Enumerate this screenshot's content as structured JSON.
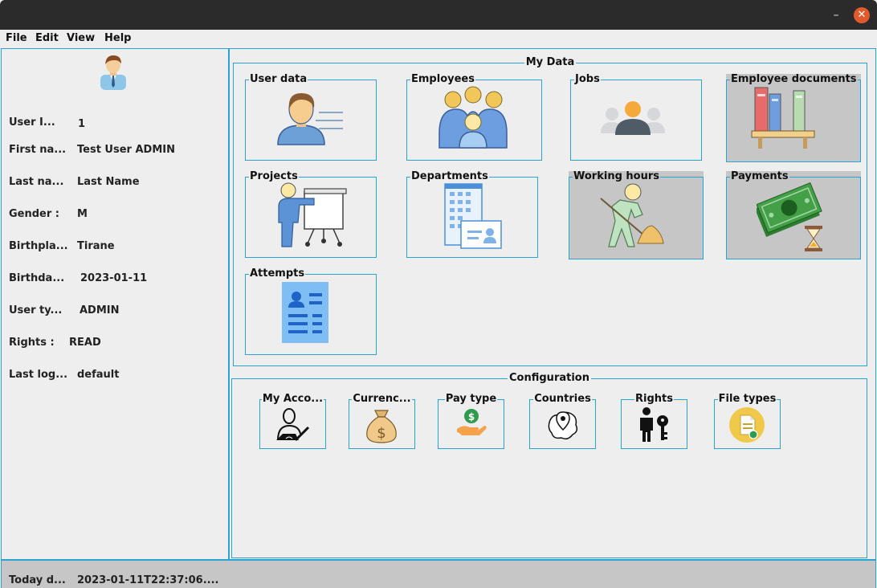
{
  "window": {
    "min_glyph": "–",
    "close_glyph": "✕"
  },
  "menu": {
    "file": "File",
    "edit": "Edit",
    "view": "View",
    "help": "Help"
  },
  "user": {
    "id_label": "User I...",
    "id_value": "1",
    "first_label": "First na...",
    "first_value": "Test User ADMIN",
    "last_label": "Last na...",
    "last_value": "Last Name",
    "gender_label": "Gender :",
    "gender_value": "M",
    "birthplace_label": "Birthpla...",
    "birthplace_value": "Tirane",
    "birthday_label": "Birthda...",
    "birthday_value": "2023-01-11",
    "type_label": "User ty...",
    "type_value": "ADMIN",
    "rights_label": "Rights  :",
    "rights_value": "READ",
    "lastlog_label": "Last log...",
    "lastlog_value": "default"
  },
  "mydata": {
    "title": "My Data",
    "user_data": "User data",
    "employees": "Employees",
    "jobs": "Jobs",
    "employee_documents": "Employee documents",
    "projects": "Projects",
    "departments": "Departments",
    "working_hours": "Working hours",
    "payments": "Payments",
    "attempts": "Attempts"
  },
  "config": {
    "title": "Configuration",
    "my_account": "My Acco...",
    "currency": "Currenc...",
    "pay_type": "Pay type",
    "countries": "Countries",
    "rights": "Rights",
    "file_types": "File types"
  },
  "status": {
    "today_label": "Today d...",
    "today_value": "2023-01-11T22:37:06...."
  },
  "colors": {
    "accent_border": "#29a3d4",
    "selected_tile": "#c6c6c6",
    "titlebar": "#2b2b2b",
    "close_button": "#e05a2b"
  }
}
